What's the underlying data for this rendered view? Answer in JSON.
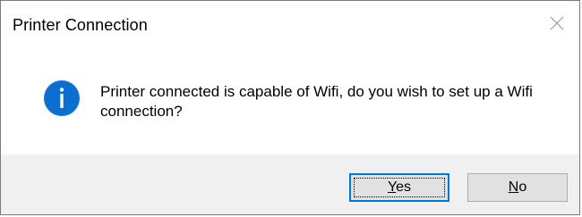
{
  "dialog": {
    "title": "Printer Connection",
    "icon": "info-icon",
    "message": "Printer connected is capable of Wifi, do you wish to set up a Wifi connection?",
    "buttons": {
      "yes": {
        "mnemonic": "Y",
        "rest": "es",
        "label": "Yes"
      },
      "no": {
        "mnemonic": "N",
        "rest": "o",
        "label": "No"
      }
    },
    "close_icon": "close-icon"
  },
  "colors": {
    "accent": "#0078d7",
    "footer_bg": "#f0f0f0",
    "button_bg": "#e1e1e1"
  }
}
